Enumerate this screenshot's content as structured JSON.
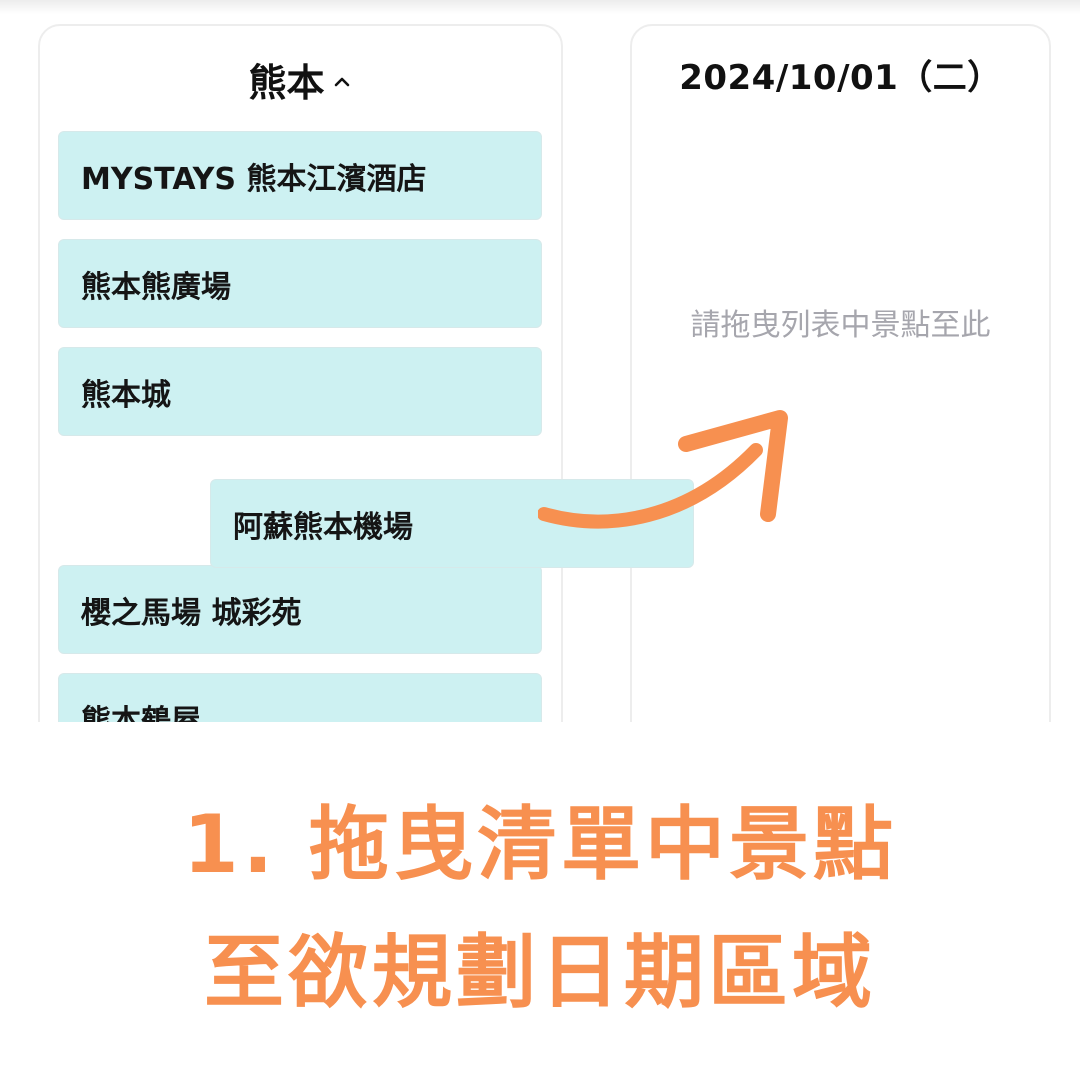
{
  "left_panel": {
    "title": "熊本",
    "collapse_icon": "chevron-up-icon",
    "items": [
      "MYSTAYS 熊本江濱酒店",
      "熊本熊廣場",
      "熊本城",
      "櫻之馬場 城彩苑",
      "熊本鶴屋"
    ]
  },
  "dragging_item": {
    "label": "阿蘇熊本機場"
  },
  "right_panel": {
    "date": "2024/10/01（二）",
    "drop_hint": "請拖曳列表中景點至此"
  },
  "arrow_icon": "curved-arrow-icon",
  "caption": {
    "line1": "1. 拖曳清單中景點",
    "line2": "至欲規劃日期區域"
  },
  "colors": {
    "accent": "#f79050",
    "card_bg": "#cdf1f2",
    "hint_text": "#a6a6ad"
  }
}
